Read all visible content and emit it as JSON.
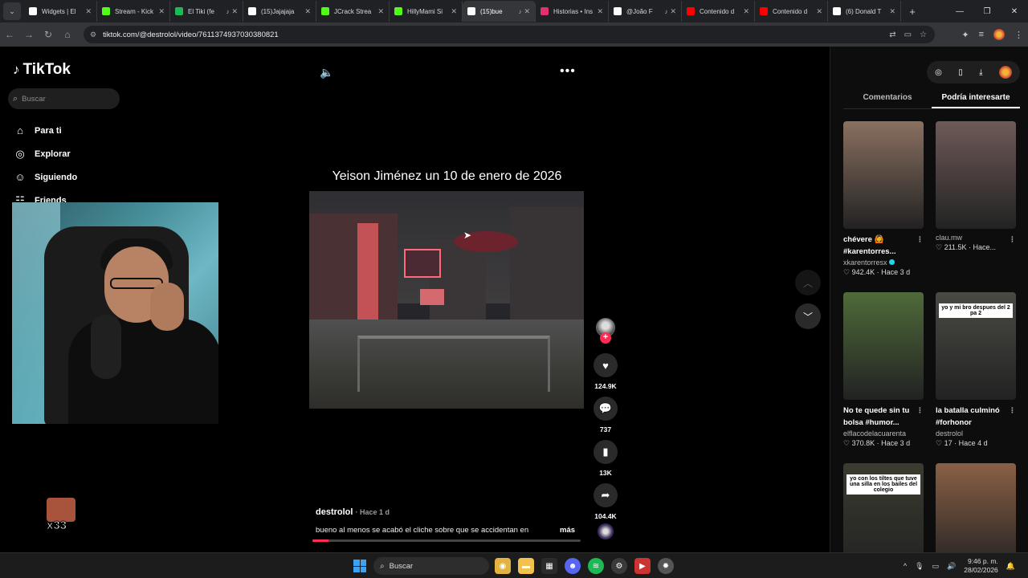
{
  "browser": {
    "tabs": [
      {
        "label": "Widgets | El",
        "icon": "widgets-icon",
        "color": "#ffffff",
        "audio": false,
        "active": false
      },
      {
        "label": "Stream - Kick",
        "icon": "kick-icon",
        "color": "#53fc18",
        "audio": false,
        "active": false
      },
      {
        "label": "El Tiki (fe",
        "icon": "spotify-icon",
        "color": "#1db954",
        "audio": true,
        "active": false
      },
      {
        "label": "(15)Jajajaja",
        "icon": "tiktok-icon",
        "color": "#ffffff",
        "audio": false,
        "active": false
      },
      {
        "label": "JCrack Strea",
        "icon": "kick-icon",
        "color": "#53fc18",
        "audio": false,
        "active": false
      },
      {
        "label": "HillyMami Si",
        "icon": "kick-icon",
        "color": "#53fc18",
        "audio": false,
        "active": false
      },
      {
        "label": "(15)bue",
        "icon": "tiktok-icon",
        "color": "#ffffff",
        "audio": true,
        "active": true
      },
      {
        "label": "Historias • Ins",
        "icon": "instagram-icon",
        "color": "#e1306c",
        "audio": false,
        "active": false
      },
      {
        "label": "@João F",
        "icon": "tiktok-icon",
        "color": "#ffffff",
        "audio": true,
        "active": false
      },
      {
        "label": "Contenido d",
        "icon": "youtube-icon",
        "color": "#ff0000",
        "audio": false,
        "active": false
      },
      {
        "label": "Contenido d",
        "icon": "youtube-icon",
        "color": "#ff0000",
        "audio": false,
        "active": false
      },
      {
        "label": "(6) Donald T",
        "icon": "x-icon",
        "color": "#ffffff",
        "audio": false,
        "active": false
      }
    ],
    "url": "tiktok.com/@destrolol/video/7611374937030380821"
  },
  "tiktok": {
    "logo": "TikTok",
    "search_placeholder": "Buscar",
    "nav": [
      {
        "label": "Para ti",
        "icon": "home-icon"
      },
      {
        "label": "Explorar",
        "icon": "compass-icon"
      },
      {
        "label": "Siguiendo",
        "icon": "following-icon"
      },
      {
        "label": "Friends",
        "icon": "friends-icon"
      }
    ],
    "emote_count": "x33",
    "video": {
      "title": "Yeison Jiménez un 10 de enero de 2026",
      "likes": "124.9K",
      "comments": "737",
      "saves": "13K",
      "shares": "104.4K",
      "author": "destrolol",
      "time": "· Hace 1 d",
      "caption": "bueno al menos se acabó el cliche sobre que se accidentan en",
      "more": "más",
      "progress": 0.06
    },
    "right_tabs": [
      "Comentarios",
      "Podría interesarte"
    ],
    "cards": [
      {
        "caption1": "chévere 🙆",
        "caption2": "#karentorres...",
        "author": "xkarentorresx",
        "verified": true,
        "likes": "942.4K",
        "time": "Hace 3 d",
        "bg": "#8a7060"
      },
      {
        "caption1": "",
        "caption2": "",
        "author": "clau.mw",
        "verified": false,
        "likes": "211.5K",
        "time": "Hace...",
        "bg": "#6e5a58"
      },
      {
        "caption1": "No te quede sin tu",
        "caption2": "bolsa #humor...",
        "author": "elflacodelacuarenta",
        "verified": false,
        "likes": "370.8K",
        "time": "Hace 3 d",
        "bg": "#4f6a3a"
      },
      {
        "caption1": "la batalla culminó",
        "caption2": "#forhonor",
        "author": "destrolol",
        "verified": false,
        "likes": "17",
        "time": "Hace 4 d",
        "bg": "#4a4a44",
        "overlay": "yo y mi bro despues del 2 pa 2"
      },
      {
        "caption1": "",
        "caption2": "",
        "author": "",
        "verified": false,
        "likes": "",
        "time": "",
        "bg": "#3b3b30",
        "overlay": "yo con los tiltes que tuve una silla en los bailes del colegio"
      },
      {
        "caption1": "",
        "caption2": "",
        "author": "",
        "verified": false,
        "likes": "",
        "time": "",
        "bg": "#8a6045"
      }
    ]
  },
  "taskbar": {
    "search": "Buscar",
    "time": "9:46 p. m.",
    "date": "28/02/2026"
  }
}
